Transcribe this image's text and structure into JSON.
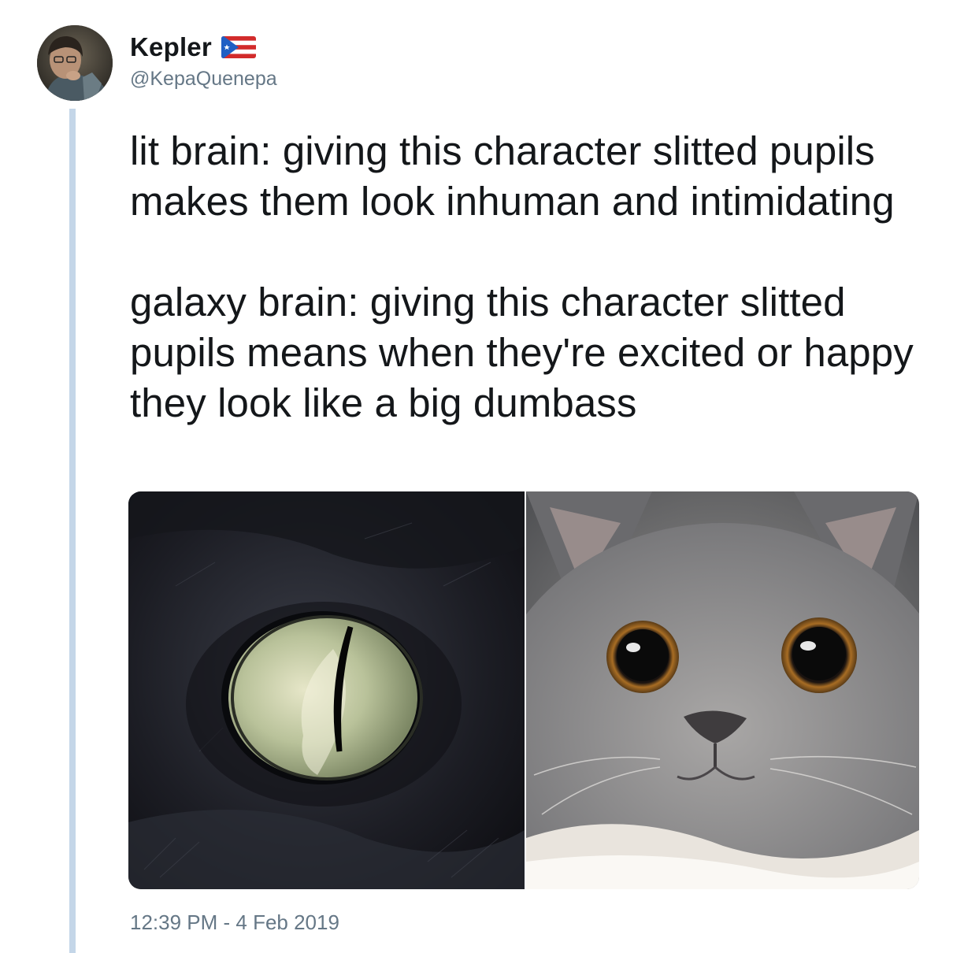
{
  "tweet": {
    "author": {
      "display_name": "Kepler",
      "handle": "@KepaQuenepa",
      "avatar_icon": "user-avatar",
      "flag_icon": "puerto-rico-flag-icon"
    },
    "text_paragraphs": [
      "lit brain: giving this character slitted pupils makes them look inhuman and intimidating",
      "galaxy brain: giving this character slitted pupils means when they're excited or happy they look like a big dumbass"
    ],
    "media": [
      {
        "icon": "black-cat-slit-eye-photo"
      },
      {
        "icon": "gray-kitten-wide-eyes-photo"
      }
    ],
    "timestamp": "12:39 PM - 4 Feb 2019"
  },
  "colors": {
    "text": "#14171a",
    "secondary_text": "#657786",
    "thread_line": "#c4d6e8",
    "background": "#ffffff"
  }
}
